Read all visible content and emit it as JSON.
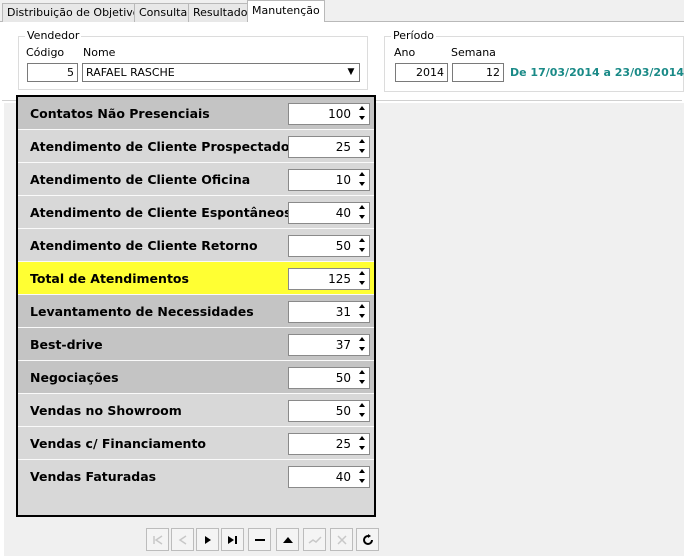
{
  "tabs": [
    {
      "label": "Distribuição de Objetivos"
    },
    {
      "label": "Consulta"
    },
    {
      "label": "Resultado"
    },
    {
      "label": "Manutenção"
    }
  ],
  "vendedor": {
    "title": "Vendedor",
    "codigo_label": "Código",
    "nome_label": "Nome",
    "codigo_value": "5",
    "nome_value": "RAFAEL RASCHE"
  },
  "periodo": {
    "title": "Período",
    "ano_label": "Ano",
    "semana_label": "Semana",
    "ano_value": "2014",
    "semana_value": "12",
    "range_text": "De 17/03/2014 a 23/03/2014",
    "range_color": "#1a8a87"
  },
  "metrics": [
    {
      "label": "Contatos Não Presenciais",
      "value": "100"
    },
    {
      "label": "Atendimento de Cliente Prospectado",
      "value": "25"
    },
    {
      "label": "Atendimento de Cliente Oficina",
      "value": "10"
    },
    {
      "label": "Atendimento de Cliente Espontâneos",
      "value": "40"
    },
    {
      "label": "Atendimento de Cliente Retorno",
      "value": "50"
    },
    {
      "label": "Total de Atendimentos",
      "value": "125"
    },
    {
      "label": "Levantamento de Necessidades",
      "value": "31"
    },
    {
      "label": "Best-drive",
      "value": "37"
    },
    {
      "label": "Negociações",
      "value": "50"
    },
    {
      "label": "Vendas no Showroom",
      "value": "50"
    },
    {
      "label": "Vendas c/ Financiamento",
      "value": "25"
    },
    {
      "label": "Vendas Faturadas",
      "value": "40"
    }
  ],
  "highlight_color": "#ffff33",
  "navigator": [
    {
      "name": "first-record-icon",
      "enabled": false
    },
    {
      "name": "prior-record-icon",
      "enabled": false
    },
    {
      "name": "next-record-icon",
      "enabled": true
    },
    {
      "name": "last-record-icon",
      "enabled": true
    },
    {
      "name": "delete-record-icon",
      "enabled": true
    },
    {
      "name": "edit-record-icon",
      "enabled": true
    },
    {
      "name": "post-record-icon",
      "enabled": false
    },
    {
      "name": "cancel-record-icon",
      "enabled": false
    },
    {
      "name": "refresh-icon",
      "enabled": true
    }
  ]
}
